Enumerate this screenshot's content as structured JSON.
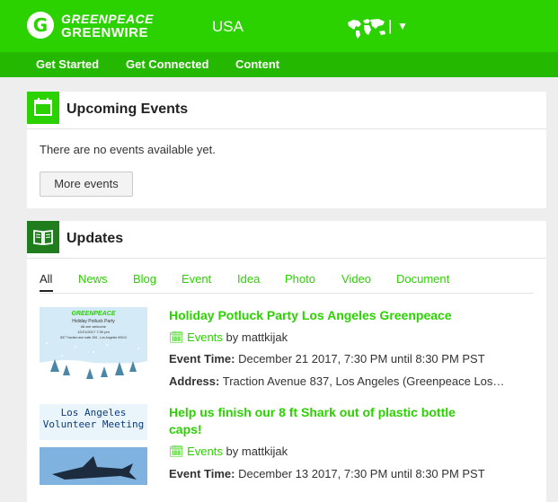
{
  "header": {
    "logo_line1": "GREENPEACE",
    "logo_line2": "GREENWIRE",
    "country": "USA",
    "world_separator": "|",
    "world_caret": "▼",
    "brand_color": "#2bd200"
  },
  "nav": {
    "items": [
      "Get Started",
      "Get Connected",
      "Content"
    ]
  },
  "events_card": {
    "icon": "calendar-icon",
    "title": "Upcoming Events",
    "empty_message": "There are no events available yet.",
    "more_button": "More events"
  },
  "updates_card": {
    "icon": "open-book-icon",
    "title": "Updates",
    "tabs": [
      "All",
      "News",
      "Blog",
      "Event",
      "Idea",
      "Photo",
      "Video",
      "Document"
    ],
    "active_tab": "All",
    "items": [
      {
        "title": "Holiday Potluck Party Los Angeles Greenpeace",
        "category": "Events",
        "by_label": "by",
        "author": "mattkijak",
        "time_label": "Event Time:",
        "time_value": "December 21 2017, 7:30 PM until 8:30 PM PST",
        "address_label": "Address:",
        "address_value": "Traction Avenue 837, Los Angeles (Greenpeace Los…",
        "thumb_text": [
          "GREENPEACE",
          "Holiday Potluck Party",
          "All are welcome",
          "12/21/2017 7:30 pm",
          "837 Traction ave suite 206 , Los Angeles 90013"
        ]
      },
      {
        "title_line1": "Help us finish our 8 ft Shark out of plastic bottle",
        "title_line2": "caps!",
        "category": "Events",
        "by_label": "by",
        "author": "mattkijak",
        "time_label": "Event Time:",
        "time_value": "December 13 2017, 7:30 PM until 8:30 PM PST",
        "thumb_text": [
          "Los Angeles",
          "Volunteer Meeting"
        ]
      }
    ]
  }
}
